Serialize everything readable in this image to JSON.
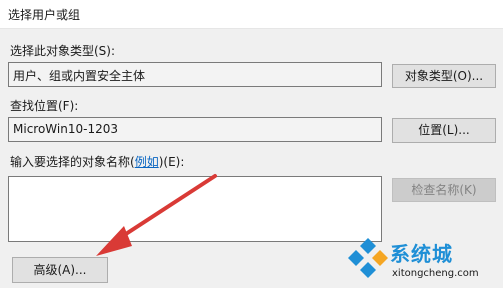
{
  "window": {
    "title": "选择用户或组"
  },
  "object_type": {
    "label": "选择此对象类型(S):",
    "value": "用户、组或内置安全主体",
    "button": "对象类型(O)..."
  },
  "location": {
    "label": "查找位置(F):",
    "value": "MicroWin10-1203",
    "button": "位置(L)..."
  },
  "object_names": {
    "label_prefix": "输入要选择的对象名称(",
    "label_link": "例如",
    "label_suffix": ")(E):",
    "value": "",
    "check_button": "检查名称(K)"
  },
  "advanced_button": "高级(A)...",
  "watermark": {
    "brand_cn": "系统城",
    "brand_url": "xitongcheng.com",
    "colors": {
      "brand": "#1f8fd6"
    }
  },
  "annotation": {
    "arrow_color": "#d93a36"
  }
}
